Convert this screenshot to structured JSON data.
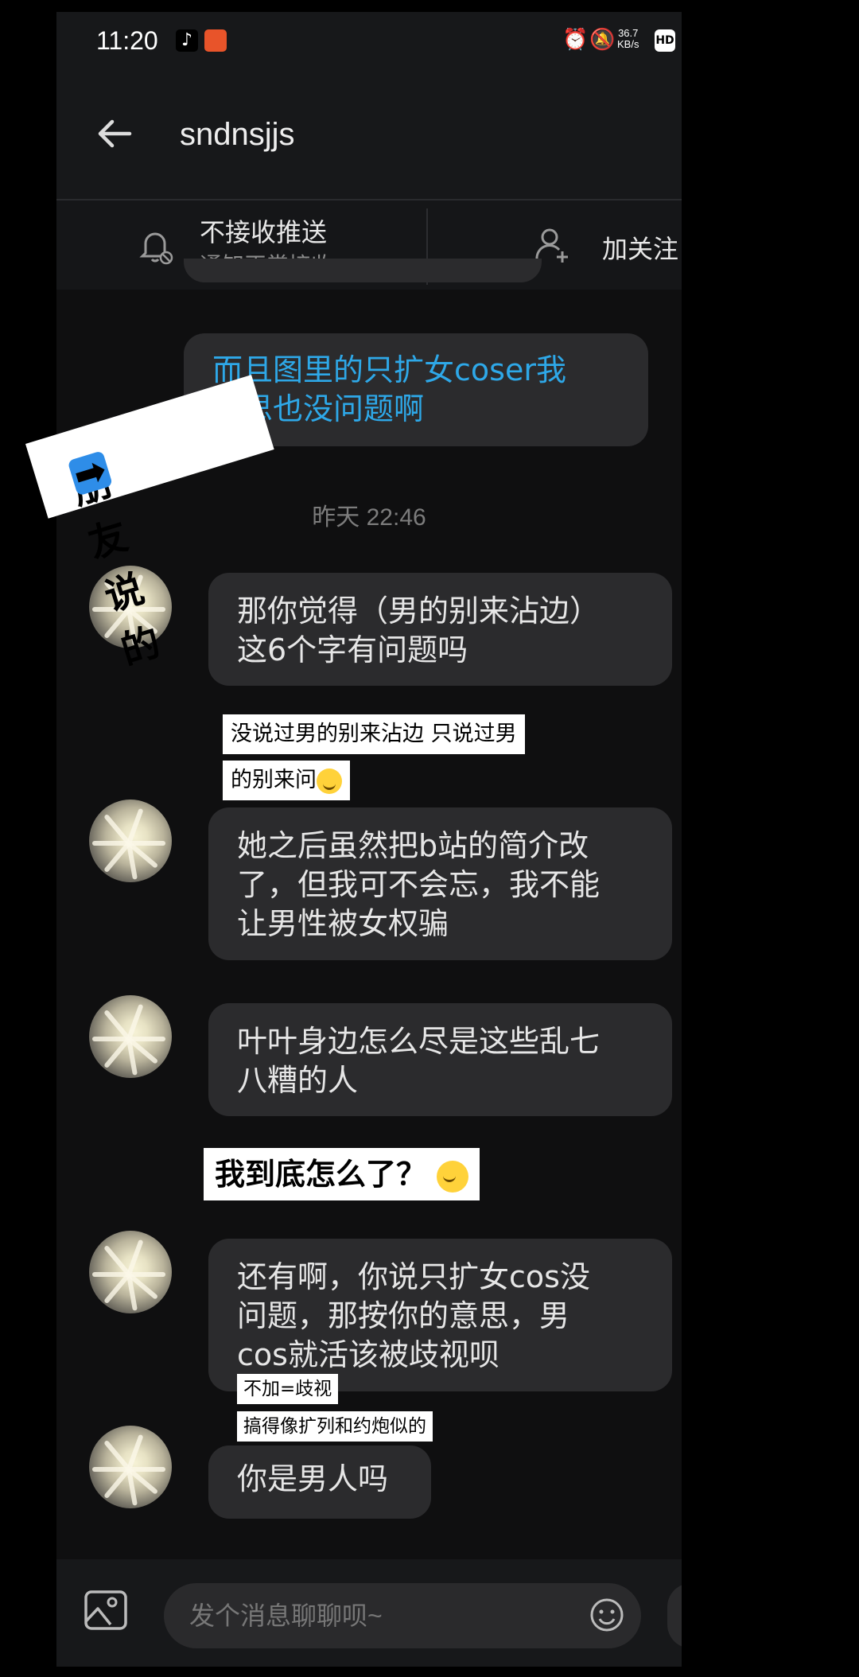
{
  "status_bar": {
    "time": "11:20",
    "net_speed": "36.7",
    "net_unit": "KB/s",
    "hd_label": "HD",
    "icons": [
      "tiktok-icon",
      "taobao-icon",
      "alarm-icon",
      "mute-icon"
    ]
  },
  "header": {
    "title": "sndnsjjs"
  },
  "subbar": {
    "mute_title": "不接收推送",
    "mute_sub": "通知正常接收",
    "follow_label": "加关注"
  },
  "messages": {
    "outgoing_1": "而且图里的只扩女coser我\n寻思也没问题啊",
    "timestamp": "昨天 22:46",
    "incoming_1": "那你觉得（男的别来沾边）\n这6个字有问题吗",
    "incoming_2": "她之后虽然把b站的简介改\n了，但我可不会忘，我不能\n让男性被女权骗",
    "incoming_3": "叶叶身边怎么尽是这些乱七\n八糟的人",
    "incoming_4": "还有啊，你说只扩女cos没\n问题，那按你的意思，男\ncos就活该被歧视呗",
    "incoming_5": "你是男人吗"
  },
  "overlays": {
    "friend_said": "朋友说的",
    "note_1_line1": "没说过男的别来沾边 只说过男",
    "note_1_line2": "的别来问",
    "note_2": "我到底怎么了？",
    "note_3": "不加=歧视",
    "note_4": "搞得像扩列和约炮似的"
  },
  "input_bar": {
    "placeholder": "发个消息聊聊呗~"
  },
  "colors": {
    "outgoing_text": "#2ea8e8",
    "bubble_bg": "#2b2b2d",
    "screen_bg": "#0f0f10"
  }
}
